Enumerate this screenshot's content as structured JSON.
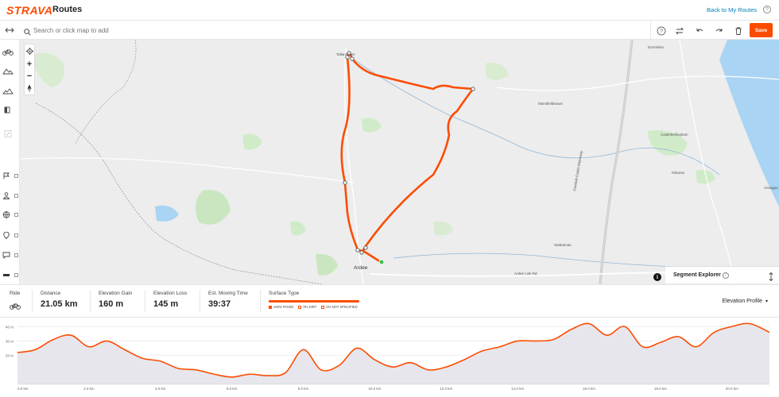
{
  "header": {
    "logo": "STRAVA",
    "title": "Routes",
    "back_link": "Back to My Routes",
    "help": "?"
  },
  "search": {
    "placeholder": "Search or click map to add"
  },
  "toolbar": {
    "save_label": "Save",
    "icons": [
      "help-icon",
      "reverse-route-icon",
      "undo-icon",
      "redo-icon",
      "clear-icon"
    ]
  },
  "sidebar": {
    "items": [
      "ride-mode",
      "elevation",
      "surface",
      "segments-toggle",
      "poi-flag",
      "person",
      "globe",
      "pin",
      "comment",
      "heatmap"
    ]
  },
  "map": {
    "towns": {
      "tallanstown": "Tallanstown",
      "ardee": "Ardee",
      "dromiskin": "Dromiskin",
      "castlebellingham": "Castlebellingham",
      "kilsaran": "Kilsaran",
      "annagassan": "Annagas",
      "mansfieldstown": "Mansfieldstown",
      "stabannan": "Stabannan"
    },
    "roads": {
      "motorway": "Dundalk-Dublin Motorway",
      "link_road": "Ardee Link Rd"
    },
    "info": "i"
  },
  "segment_explorer": {
    "title": "Segment Explorer",
    "info": "i"
  },
  "stats": {
    "ride_label": "Ride",
    "distance_label": "Distance",
    "distance_value": "21.05 km",
    "elev_gain_label": "Elevation Gain",
    "elev_gain_value": "160 m",
    "elev_loss_label": "Elevation Loss",
    "elev_loss_value": "145 m",
    "moving_time_label": "Est. Moving Time",
    "moving_time_value": "39:37",
    "surface_label": "Surface Type",
    "surface_paved": "100% PAVED",
    "surface_dirt": "0% DIRT",
    "surface_unspecified": "0% NOT SPECIFIED",
    "elevation_profile_link": "Elevation Profile"
  },
  "colors": {
    "brand": "#fc4c02",
    "link": "#007fb6",
    "route": "#fc4c02",
    "map_bg": "#ededed",
    "green": "#cfe8c8",
    "water": "#a9d4f3"
  },
  "chart_data": {
    "type": "area",
    "x": [
      0.0,
      0.5,
      1.0,
      1.5,
      2.0,
      2.5,
      3.0,
      3.5,
      4.0,
      4.5,
      5.0,
      5.5,
      6.0,
      6.5,
      7.0,
      7.5,
      8.0,
      8.5,
      9.0,
      9.5,
      10.0,
      10.5,
      11.0,
      11.5,
      12.0,
      12.5,
      13.0,
      13.5,
      14.0,
      14.5,
      15.0,
      15.5,
      16.0,
      16.5,
      17.0,
      17.5,
      18.0,
      18.5,
      19.0,
      19.5,
      20.0,
      20.5,
      21.05
    ],
    "values": [
      22,
      24,
      31,
      34,
      26,
      30,
      24,
      18,
      16,
      11,
      10,
      7,
      5,
      7,
      6,
      8,
      24,
      10,
      13,
      25,
      17,
      12,
      15,
      10,
      12,
      17,
      23,
      26,
      30,
      30,
      31,
      38,
      42,
      34,
      40,
      26,
      29,
      33,
      26,
      36,
      40,
      42,
      36
    ],
    "x_ticks": [
      "0.0 km",
      "2.0 km",
      "4.0 km",
      "6.0 km",
      "8.0 km",
      "10.0 km",
      "12.0 km",
      "14.0 km",
      "16.0 km",
      "18.0 km",
      "20.0 km"
    ],
    "y_ticks": [
      "40 m",
      "30 m",
      "20 m"
    ],
    "ylim": [
      0,
      44
    ],
    "xlim": [
      0,
      21.05
    ]
  }
}
